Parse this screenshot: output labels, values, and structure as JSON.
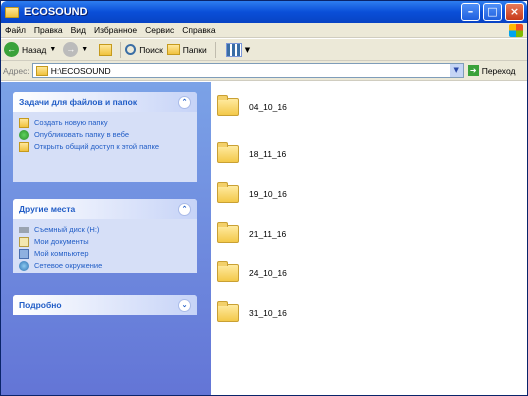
{
  "window": {
    "title": "ECOSOUND"
  },
  "menu": [
    "Файл",
    "Правка",
    "Вид",
    "Избранное",
    "Сервис",
    "Справка"
  ],
  "toolbar": {
    "back_label": "Назад",
    "search_label": "Поиск",
    "folders_label": "Папки"
  },
  "address": {
    "label": "Адрес:",
    "value": "H:\\ECOSOUND",
    "go_label": "Переход"
  },
  "sidebar": {
    "tasks": {
      "title": "Задачи для файлов и папок",
      "items": [
        "Создать новую папку",
        "Опубликовать папку в вебе",
        "Открыть общий доступ к этой папке"
      ]
    },
    "places": {
      "title": "Другие места",
      "items": [
        "Съемный диск (H:)",
        "Мои документы",
        "Мой компьютер",
        "Сетевое окружение"
      ]
    },
    "details": {
      "title": "Подробно"
    }
  },
  "folders": [
    "04_10_16",
    "18_11_16",
    "19_10_16",
    "21_11_16",
    "24_10_16",
    "31_10_16"
  ]
}
